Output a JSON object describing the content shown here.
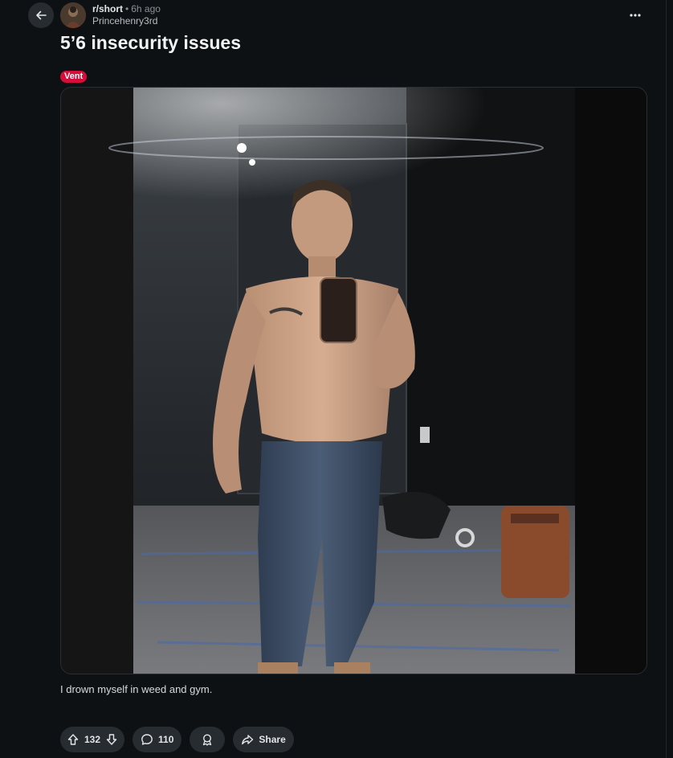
{
  "post": {
    "subreddit": "r/short",
    "separator": "•",
    "time": "6h ago",
    "author": "Princehenry3rd",
    "title": "5’6 insecurity issues",
    "flair": "Vent",
    "flair_color": "#d40d3a",
    "body": "I drown myself in weed and gym."
  },
  "actions": {
    "score": "132",
    "comments": "110",
    "share_label": "Share"
  },
  "icons": {
    "back": "arrow-left-icon",
    "more": "more-horizontal-icon",
    "upvote": "upvote-arrow-icon",
    "downvote": "downvote-arrow-icon",
    "comment": "comment-bubble-icon",
    "award": "award-icon",
    "share": "share-arrow-icon"
  }
}
